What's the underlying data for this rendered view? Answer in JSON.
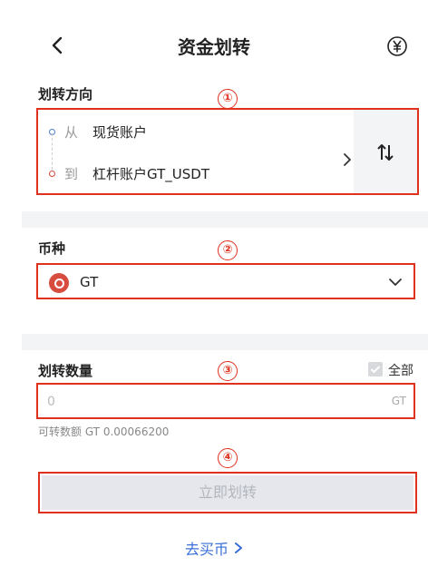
{
  "header": {
    "title": "资金划转",
    "back_icon": "chevron-left-icon",
    "currency_icon": "yuan-circle-icon"
  },
  "direction": {
    "label": "划转方向",
    "from_prep": "从",
    "from_value": "现货账户",
    "to_prep": "到",
    "to_value": "杠杆账户GT_USDT",
    "swap_icon": "swap-vertical-icon"
  },
  "coin": {
    "label": "币种",
    "selected": "GT"
  },
  "amount": {
    "label": "划转数量",
    "all_label": "全部",
    "placeholder": "0",
    "unit": "GT",
    "available": "可转数额 GT 0.00066200"
  },
  "submit": {
    "label": "立即划转"
  },
  "buy_link": {
    "label": "去买币"
  },
  "annotations": [
    "①",
    "②",
    "③",
    "④"
  ],
  "colors": {
    "annotation_red": "#e0301e",
    "link_blue": "#3a6fd8",
    "disabled_button": "#e5e7ec",
    "coin_logo": "#d84b3f"
  }
}
